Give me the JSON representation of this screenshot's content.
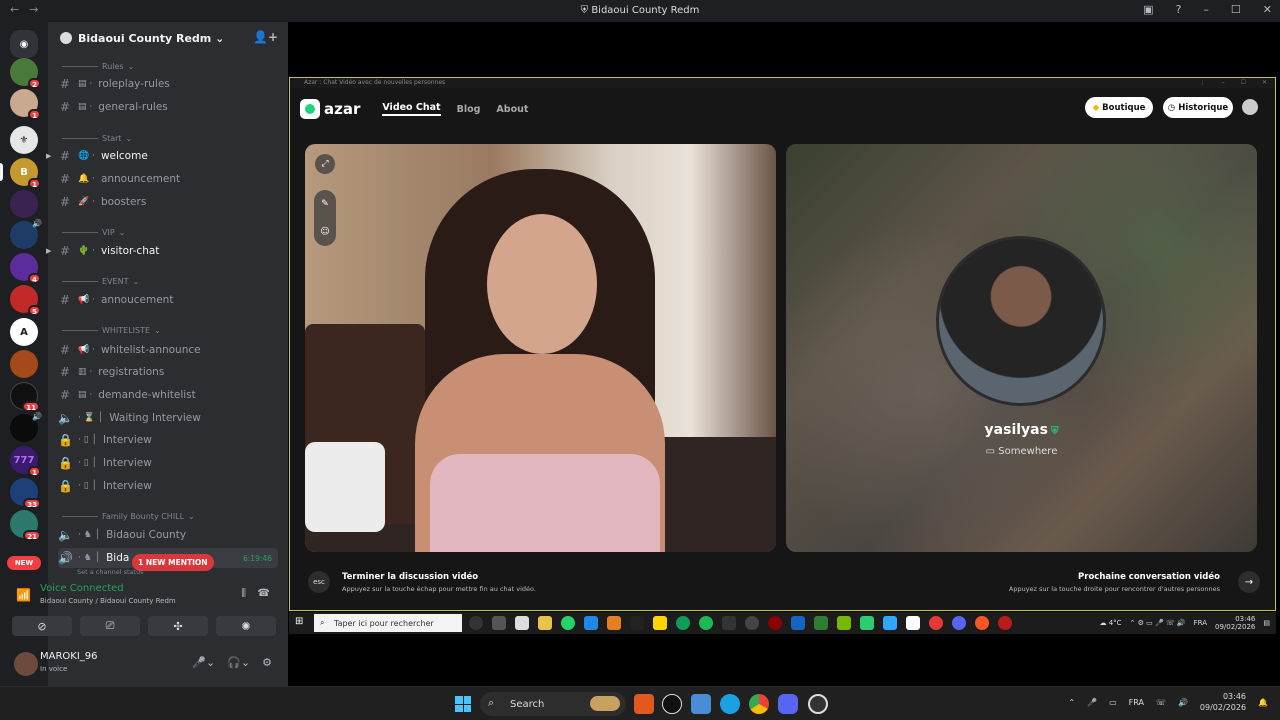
{
  "window": {
    "title": "Bidaoui County Redm"
  },
  "guild": {
    "name": "Bidaoui County Redm"
  },
  "server_badges": [
    "2",
    "1",
    "",
    "1",
    "",
    "",
    "4",
    "5",
    "",
    "",
    "11",
    "",
    "1",
    "33",
    "21"
  ],
  "categories": {
    "rules": "Rules",
    "start": "Start",
    "vip": "VIP",
    "event": "EVENT",
    "whiteliste": "WHITELISTE",
    "family": "Family Bounty CHILL"
  },
  "channels": {
    "roleplay_rules": "roleplay-rules",
    "general_rules": "general-rules",
    "welcome": "welcome",
    "announcement": "announcement",
    "boosters": "boosters",
    "visitor_chat": "visitor-chat",
    "annoucement": "annoucement",
    "whitelist_announce": "whitelist-announce",
    "registrations": "registrations",
    "demande_whitelist": "demande-whitelist",
    "waiting_interview": "Waiting Interview",
    "interview1": "Interview",
    "interview2": "Interview",
    "interview3": "Interview",
    "bidaoui_county": "Bidaoui County",
    "bidaoui_partial": "Bida"
  },
  "mention": "1 NEW MENTION",
  "new_badge": "NEW",
  "timer": "6:19:46",
  "set_status": "Set a channel status",
  "voice": {
    "status": "Voice Connected",
    "location": "Bidaoui County / Bidaoui County Redm"
  },
  "user": {
    "name": "MAROKI_96",
    "status": "In voice"
  },
  "azar": {
    "titlebar": "Azar : Chat Vidéo avec de nouvelles personnes",
    "logo": "azar",
    "nav": [
      "Video Chat",
      "Blog",
      "About"
    ],
    "boutique": "Boutique",
    "historique": "Historique",
    "partner_name": "yasilyas",
    "partner_location": "Somewhere",
    "footer_left_title": "Terminer la discussion vidéo",
    "footer_left_sub": "Appuyez sur la touche échap pour mettre fin au chat vidéo.",
    "footer_right_title": "Prochaine conversation vidéo",
    "footer_right_sub": "Appuyez sur la touche droite pour rencontrer d'autres personnes",
    "esc": "esc"
  },
  "inner_taskbar": {
    "search_placeholder": "Taper ici pour rechercher",
    "weather": "4°C",
    "lang": "FRA",
    "time": "03:46",
    "date": "09/02/2026"
  },
  "taskbar": {
    "search": "Search",
    "lang": "FRA",
    "time": "03:46",
    "date": "09/02/2026"
  },
  "colors": {
    "discord_green": "#23a55a",
    "azar_green": "#1bd67e",
    "accent_border": "#c7c24a"
  }
}
